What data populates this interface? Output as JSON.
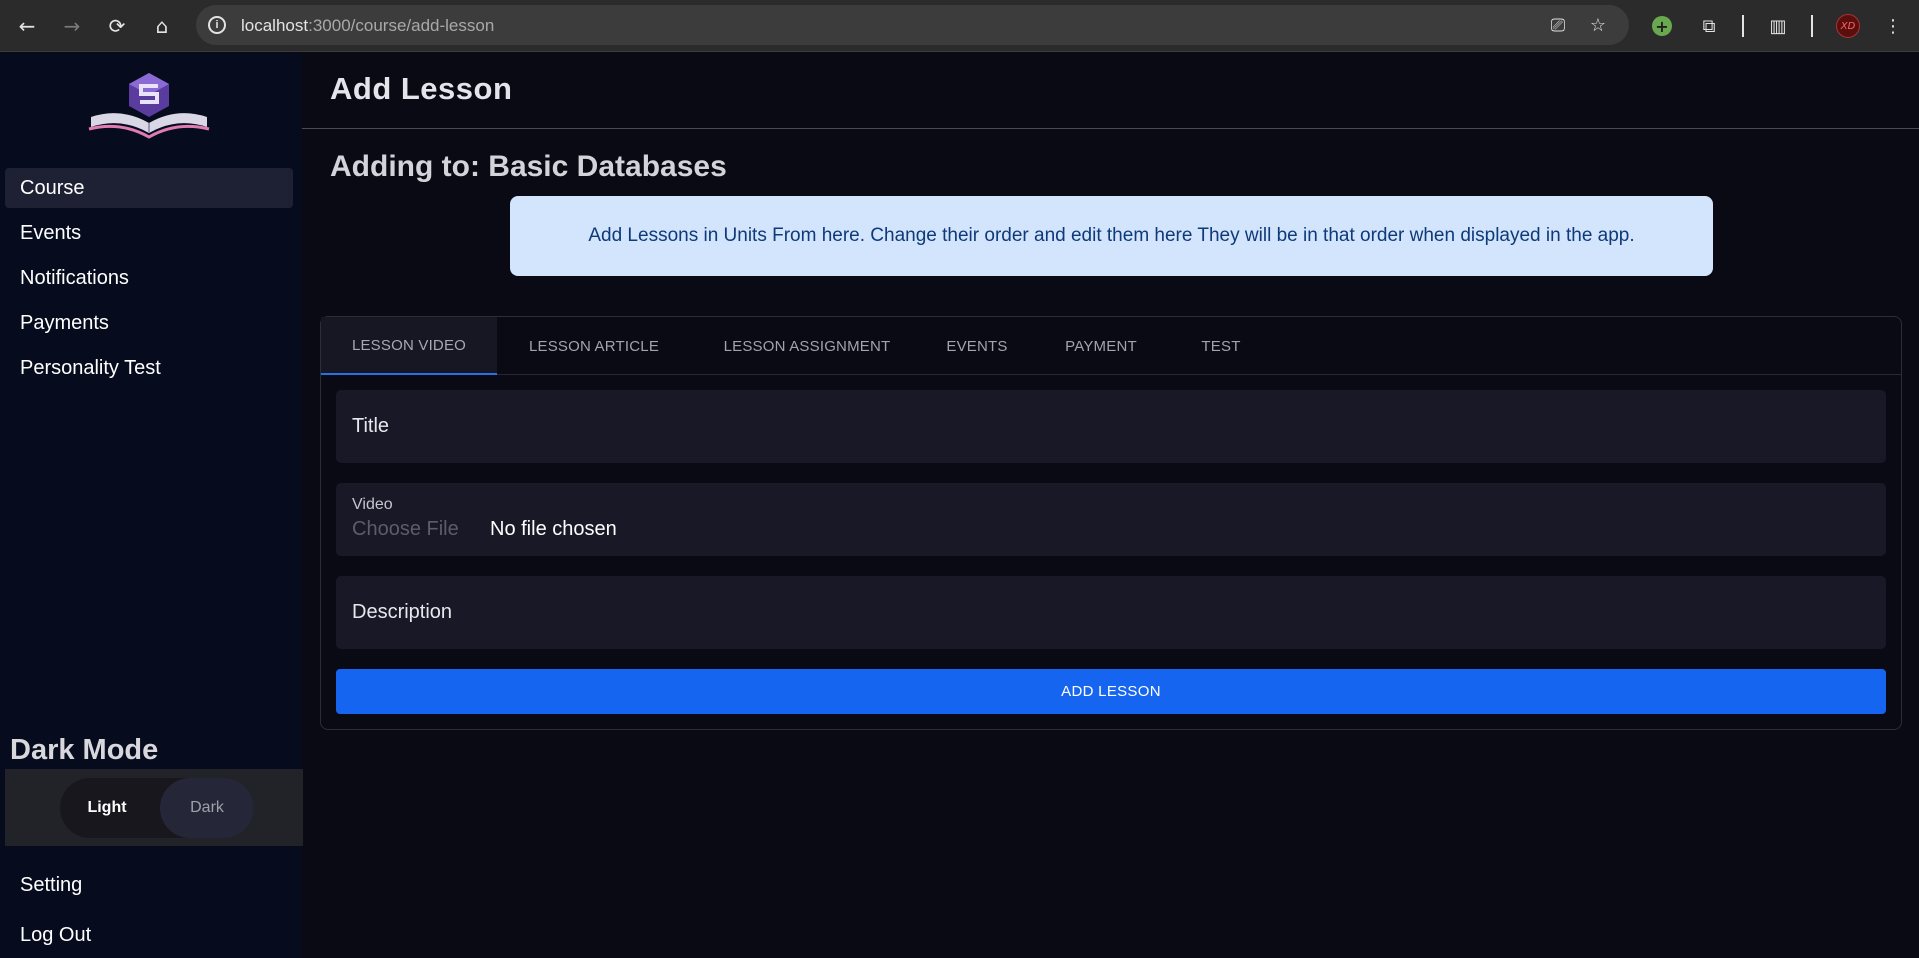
{
  "browser": {
    "url_host": "localhost",
    "url_rest": ":3000/course/add-lesson",
    "avatar_text": "XD"
  },
  "sidebar": {
    "items": [
      {
        "label": "Course"
      },
      {
        "label": "Events"
      },
      {
        "label": "Notifications"
      },
      {
        "label": "Payments"
      },
      {
        "label": "Personality Test"
      }
    ],
    "dark_mode_title": "Dark Mode",
    "toggle": {
      "light": "Light",
      "dark": "Dark",
      "selected": "Dark"
    },
    "bottom_items": [
      {
        "label": "Setting"
      },
      {
        "label": "Log Out"
      }
    ]
  },
  "main": {
    "title": "Add Lesson",
    "subtitle": "Adding to: Basic Databases",
    "info": "Add Lessons in Units From here. Change their order and edit them here They will be in that order when displayed in the app.",
    "tabs": [
      {
        "label": "LESSON VIDEO",
        "active": true
      },
      {
        "label": "LESSON ARTICLE"
      },
      {
        "label": "LESSON ASSIGNMENT"
      },
      {
        "label": "EVENTS"
      },
      {
        "label": "PAYMENT"
      },
      {
        "label": "TEST"
      }
    ],
    "form": {
      "title_label": "Title",
      "video_label": "Video",
      "choose_file": "Choose File",
      "no_file": "No file chosen",
      "description_label": "Description",
      "submit": "ADD LESSON"
    }
  },
  "colors": {
    "accent": "#1565f0",
    "sidebar_bg": "#060b1e",
    "page_bg": "#0a0a14",
    "info_bg": "#d3e4fd"
  }
}
